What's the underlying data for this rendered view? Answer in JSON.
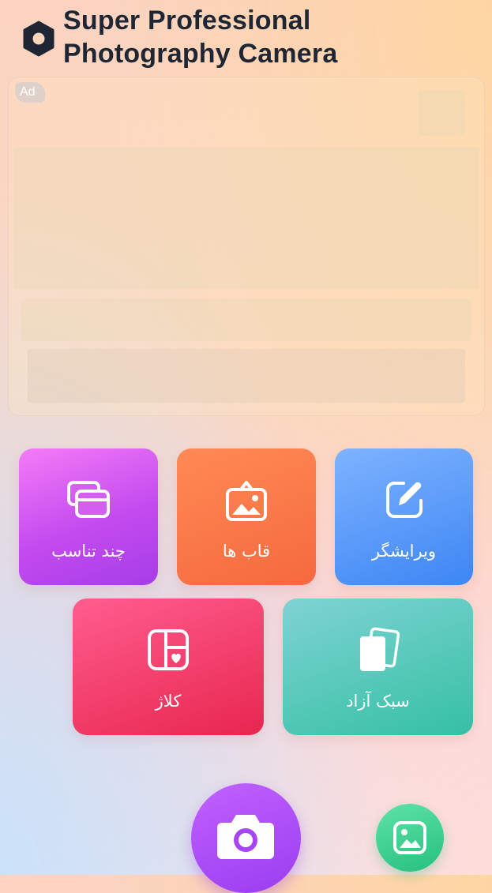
{
  "app": {
    "title_line1": "Super Professional",
    "title_line2": "Photography Camera",
    "logo_icon": "hexagon-camera-logo-icon"
  },
  "ad": {
    "badge": "Ad"
  },
  "tiles": [
    {
      "label": "چند تناسب",
      "icon": "multi-ratio-icon",
      "color": "#c44bef"
    },
    {
      "label": "قاب ها",
      "icon": "frame-picture-icon",
      "color": "#f5693e"
    },
    {
      "label": "ویرایشگر",
      "icon": "edit-icon",
      "color": "#3d86f4"
    },
    {
      "label": "کلاژ",
      "icon": "collage-heart-icon",
      "color": "#e8264f"
    },
    {
      "label": "سبک آزاد",
      "icon": "freestyle-cards-icon",
      "color": "#35c0a4"
    }
  ],
  "bottom": {
    "camera_icon": "camera-icon",
    "gallery_icon": "gallery-icon",
    "camera_color": "#9a3df0",
    "gallery_color": "#25c07e"
  }
}
